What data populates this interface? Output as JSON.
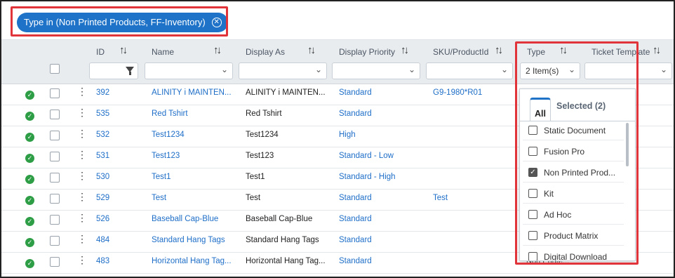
{
  "filter_chip": {
    "label": "Type in (Non Printed Products, FF-Inventory)",
    "close_glyph": "✕"
  },
  "columns": [
    {
      "label": "ID",
      "sort_glyph": "↑↓"
    },
    {
      "label": "Name",
      "sort_glyph": "↑↓"
    },
    {
      "label": "Display As",
      "sort_glyph": "↑↓"
    },
    {
      "label": "Display Priority",
      "sort_glyph": "↑↓"
    },
    {
      "label": "SKU/ProductId",
      "sort_glyph": "↑↓"
    },
    {
      "label": "Type",
      "sort_glyph": "↑↓"
    },
    {
      "label": "Ticket Template",
      "sort_glyph": "↑↓"
    }
  ],
  "type_filter_value": "2 Item(s)",
  "chevron_glyph": "⌄",
  "rows": [
    {
      "id": "392",
      "name": "ALINITY i MAINTEN...",
      "display_as": "ALINITY i MAINTEN...",
      "priority": "Standard",
      "sku": "G9-1980*R01"
    },
    {
      "id": "535",
      "name": "Red Tshirt",
      "display_as": "Red Tshirt",
      "priority": "Standard",
      "sku": ""
    },
    {
      "id": "532",
      "name": "Test1234",
      "display_as": "Test1234",
      "priority": "High",
      "sku": ""
    },
    {
      "id": "531",
      "name": "Test123",
      "display_as": "Test123",
      "priority": "Standard - Low",
      "sku": ""
    },
    {
      "id": "530",
      "name": "Test1",
      "display_as": "Test1",
      "priority": "Standard - High",
      "sku": ""
    },
    {
      "id": "529",
      "name": "Test",
      "display_as": "Test",
      "priority": "Standard",
      "sku": "Test"
    },
    {
      "id": "526",
      "name": "Baseball Cap-Blue",
      "display_as": "Baseball Cap-Blue",
      "priority": "Standard",
      "sku": ""
    },
    {
      "id": "484",
      "name": "Standard Hang Tags",
      "display_as": "Standard Hang Tags",
      "priority": "Standard",
      "sku": ""
    },
    {
      "id": "483",
      "name": "Horizontal Hang Tag...",
      "display_as": "Horizontal Hang Tag...",
      "priority": "Standard",
      "sku": ""
    }
  ],
  "status_glyph": "✓",
  "kebab_glyph": "⋮",
  "dropdown": {
    "tab_all": "All",
    "tab_selected": "Selected (2)",
    "options": [
      {
        "label": "Static Document",
        "checked": false
      },
      {
        "label": "Fusion Pro",
        "checked": false
      },
      {
        "label": "Non Printed Prod...",
        "checked": true
      },
      {
        "label": "Kit",
        "checked": false
      },
      {
        "label": "Ad Hoc",
        "checked": false
      },
      {
        "label": "Product Matrix",
        "checked": false
      },
      {
        "label": "Digital Download",
        "checked": false
      }
    ],
    "check_glyph": "✓"
  },
  "partial_type_text": "Non Printe...",
  "colors": {
    "accent": "#1e73c8",
    "link": "#1e6ec8",
    "highlight": "#e0343a",
    "status_ok": "#2e9e46",
    "header_bg": "#e9ecef"
  }
}
